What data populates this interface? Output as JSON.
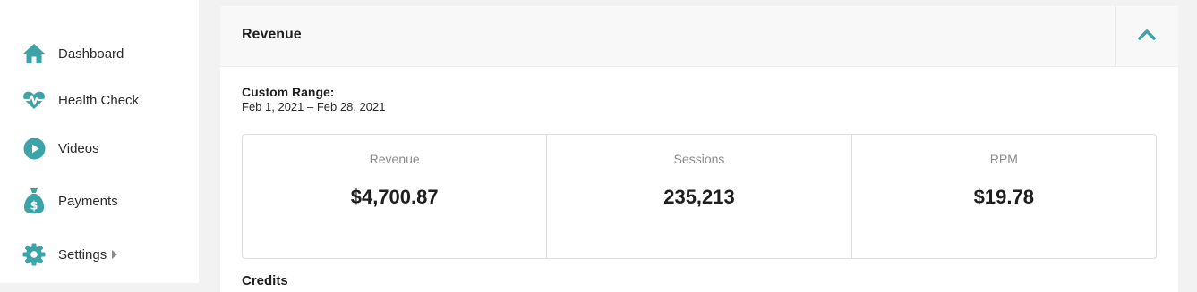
{
  "colors": {
    "accent": "#3ca3a8",
    "background": "#f2f2f2"
  },
  "sidebar": {
    "items": [
      {
        "label": "Dashboard",
        "icon": "home-icon"
      },
      {
        "label": "Health Check",
        "icon": "heartbeat-icon"
      },
      {
        "label": "Videos",
        "icon": "play-circle-icon"
      },
      {
        "label": "Payments",
        "icon": "money-bag-icon"
      },
      {
        "label": "Settings",
        "icon": "gear-icon",
        "has_submenu": true
      }
    ]
  },
  "card": {
    "title": "Revenue",
    "collapse_icon": "chevron-up-icon",
    "range_label": "Custom Range:",
    "range_value": "Feb 1, 2021 – Feb 28, 2021",
    "stats": [
      {
        "label": "Revenue",
        "value": "$4,700.87"
      },
      {
        "label": "Sessions",
        "value": "235,213"
      },
      {
        "label": "RPM",
        "value": "$19.78"
      }
    ],
    "next_section": "Credits"
  }
}
